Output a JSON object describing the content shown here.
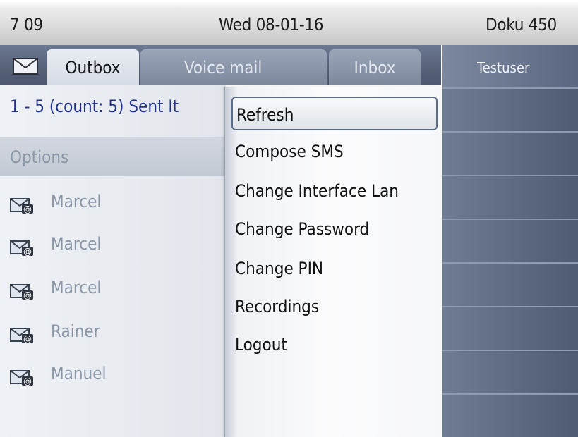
{
  "status": {
    "time": "7 09",
    "date": "Wed 08-01-16",
    "name": "Doku 450"
  },
  "tabs": {
    "outbox": "Outbox",
    "voicemail": "Voice mail",
    "inbox": "Inbox"
  },
  "list": {
    "info": "1 - 5 (count: 5) Sent It",
    "options": "Options",
    "messages": [
      "Marcel",
      "Marcel",
      "Marcel",
      "Rainer",
      "Manuel"
    ]
  },
  "menu": {
    "items": [
      "Refresh",
      "Compose SMS",
      "Change Interface Lan",
      "Change Password",
      "Change PIN",
      "Recordings",
      "Logout"
    ],
    "selected": "Refresh"
  },
  "right": {
    "title": "Testuser"
  },
  "icons": {
    "mailbox": "envelope-icon",
    "message": "email-message-icon"
  },
  "colors": {
    "accent_text": "#23338a",
    "tab_active": "#e2e6ec",
    "panel_dark": "#56627a"
  }
}
